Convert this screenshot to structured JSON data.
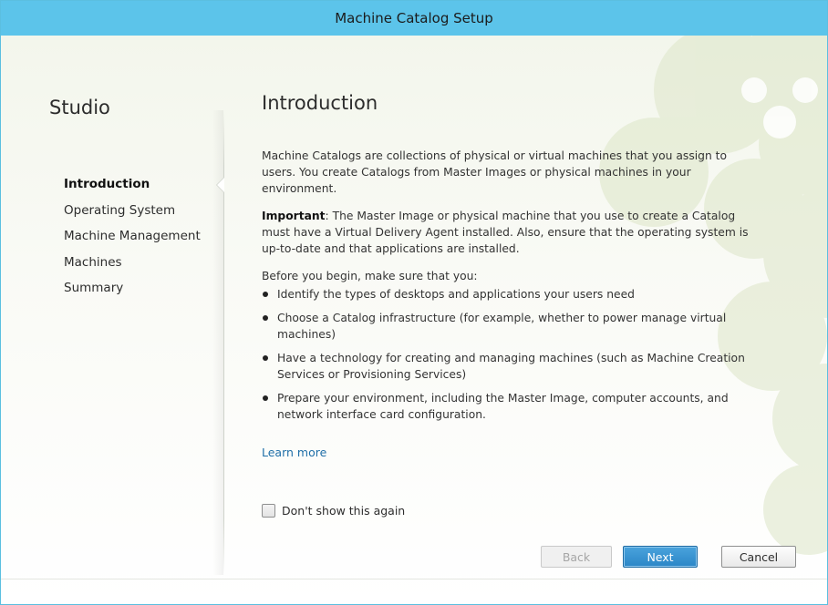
{
  "window": {
    "title": "Machine Catalog Setup"
  },
  "sidebar": {
    "title": "Studio",
    "items": [
      {
        "label": "Introduction",
        "active": true
      },
      {
        "label": "Operating System",
        "active": false
      },
      {
        "label": "Machine Management",
        "active": false
      },
      {
        "label": "Machines",
        "active": false
      },
      {
        "label": "Summary",
        "active": false
      }
    ]
  },
  "main": {
    "title": "Introduction",
    "intro": "Machine Catalogs are collections of physical or virtual machines that you assign to users. You create Catalogs from Master Images or physical machines in your environment.",
    "important_label": "Important",
    "important_text": ": The Master Image or physical machine that you use to create a Catalog must have a Virtual Delivery Agent installed. Also, ensure that the operating system is up-to-date and that applications are installed.",
    "before_begin": "Before you begin, make sure that you:",
    "bullets": [
      "Identify the types of desktops and applications your users need",
      "Choose a Catalog infrastructure (for example, whether to power manage virtual machines)",
      "Have a technology for creating and managing machines (such as Machine Creation Services or Provisioning Services)",
      "Prepare your environment, including the Master Image, computer accounts, and network interface card configuration."
    ],
    "learn_more": "Learn more",
    "dont_show": "Don't show this again"
  },
  "buttons": {
    "back": "Back",
    "next": "Next",
    "cancel": "Cancel"
  },
  "colors": {
    "titlebar": "#5cc4ea",
    "accent": "#2b86c7",
    "link": "#1f6fa8"
  }
}
